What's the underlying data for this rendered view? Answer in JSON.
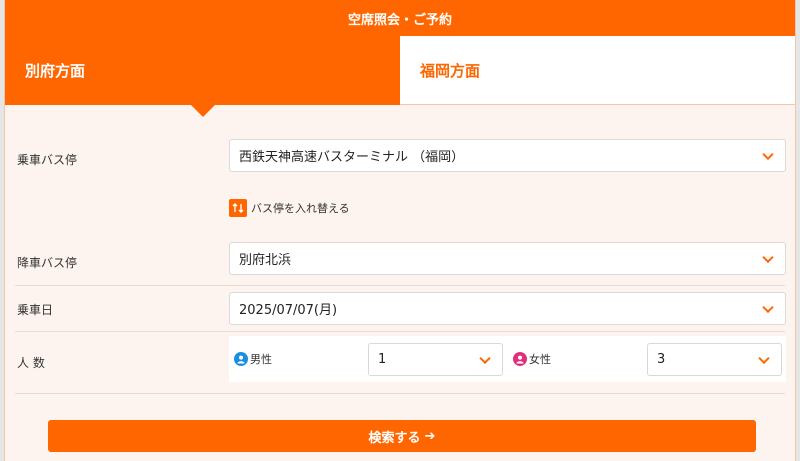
{
  "header": {
    "title": "空席照会・ご予約"
  },
  "tabs": [
    {
      "label": "別府方面",
      "active": true
    },
    {
      "label": "福岡方面",
      "active": false
    }
  ],
  "form": {
    "boarding": {
      "label": "乗車バス停",
      "value": "西鉄天神高速バスターミナル （福岡）"
    },
    "swap_label": "バス停を入れ替える",
    "alighting": {
      "label": "降車バス停",
      "value": "別府北浜"
    },
    "date": {
      "label": "乗車日",
      "value": "2025/07/07(月)"
    },
    "passengers": {
      "label": "人 数",
      "male_label": "男性",
      "male_value": "1",
      "female_label": "女性",
      "female_value": "3"
    }
  },
  "search_button": {
    "label": "検索する",
    "arrow": "➔"
  },
  "colors": {
    "accent": "#ff6600",
    "male_icon": "#1a8fe0",
    "female_icon": "#e0307a",
    "panel_bg": "#fdf4ef"
  },
  "icons": {
    "dropdown": "chevron-down-icon",
    "swap": "swap-arrows-icon",
    "male": "male-user-icon",
    "female": "female-user-icon",
    "search_arrow": "arrow-right-icon"
  }
}
